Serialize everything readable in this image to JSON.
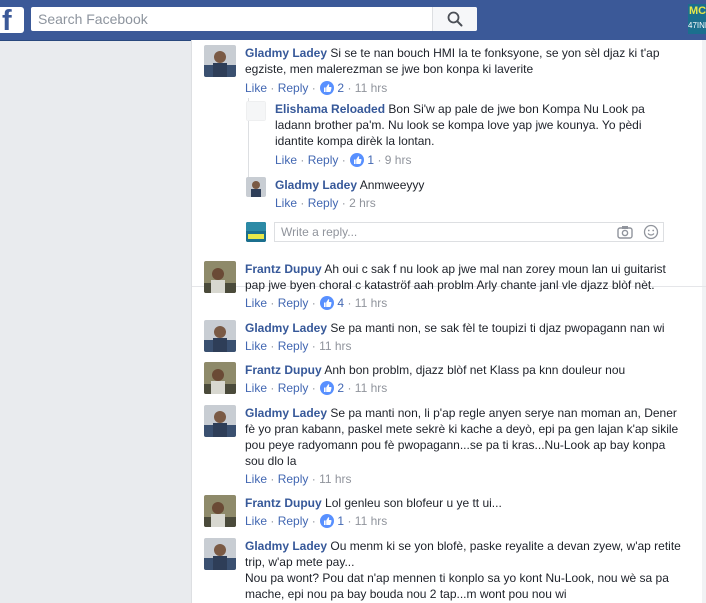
{
  "header": {
    "logo_letter": "f",
    "search_placeholder": "Search Facebook",
    "corner_badge_top": "MC",
    "corner_badge_bottom": "47INE"
  },
  "reply_box": {
    "placeholder": "Write a reply..."
  },
  "actions": {
    "like": "Like",
    "reply": "Reply",
    "sep": "·"
  },
  "comments": [
    {
      "author": "Gladmy Ladey",
      "text": "Si se te nan bouch HMI la te fonksyone, se yon sèl djaz ki t'ap egziste, men malerezman se jwe bon konpa ki laverite",
      "likes": "2",
      "time": "11 hrs"
    },
    {
      "author": "Elishama Reloaded",
      "text": "Bon Si'w ap pale de jwe bon Kompa Nu Look pa ladann brother pa'm. Nu look se kompa love yap jwe kounya. Yo pèdi idantite kompa dirèk la lontan.",
      "likes": "1",
      "time": "9 hrs"
    },
    {
      "author": "Gladmy Ladey",
      "text": "Anmweeyyy",
      "likes": "",
      "time": "2 hrs"
    },
    {
      "author": "Frantz Dupuy",
      "text": "Ah oui c sak f nu look ap jwe mal nan zorey moun lan ui guitarist pap jwe byen choral c kataströf aah problm Arly chante janl vle djazz blòf nèt.",
      "likes": "4",
      "time": "11 hrs"
    },
    {
      "author": "Gladmy Ladey",
      "text": "Se pa manti non, se sak fèl te toupizi ti djaz pwopagann nan wi",
      "likes": "",
      "time": "11 hrs"
    },
    {
      "author": "Frantz Dupuy",
      "text": "Anh bon problm, djazz blòf net Klass pa knn douleur nou",
      "likes": "2",
      "time": "11 hrs"
    },
    {
      "author": "Gladmy Ladey",
      "text": "Se pa manti non, li p'ap regle anyen serye nan moman an, Dener fè yo pran kabann, paskel mete sekrè ki kache a deyò, epi pa gen lajan k'ap sikile pou peye radyomann pou fè pwopagann...se pa ti kras...Nu-Look ap bay konpa sou dlo la",
      "likes": "",
      "time": "11 hrs"
    },
    {
      "author": "Frantz Dupuy",
      "text": "Lol genleu son blofeur u ye tt ui...",
      "likes": "1",
      "time": "11 hrs"
    },
    {
      "author": "Gladmy Ladey",
      "text": "Ou menm ki se yon blofè, paske reyalite a devan zyew, w'ap retite trip, w'ap mete pay...",
      "text2": "Nou pa wont? Pou dat n'ap mennen ti konplo sa yo kont Nu-Look, nou wè sa pa mache, epi nou pa bay bouda nou 2 tap...m wont pou nou wi",
      "likes": "",
      "time": ""
    }
  ]
}
